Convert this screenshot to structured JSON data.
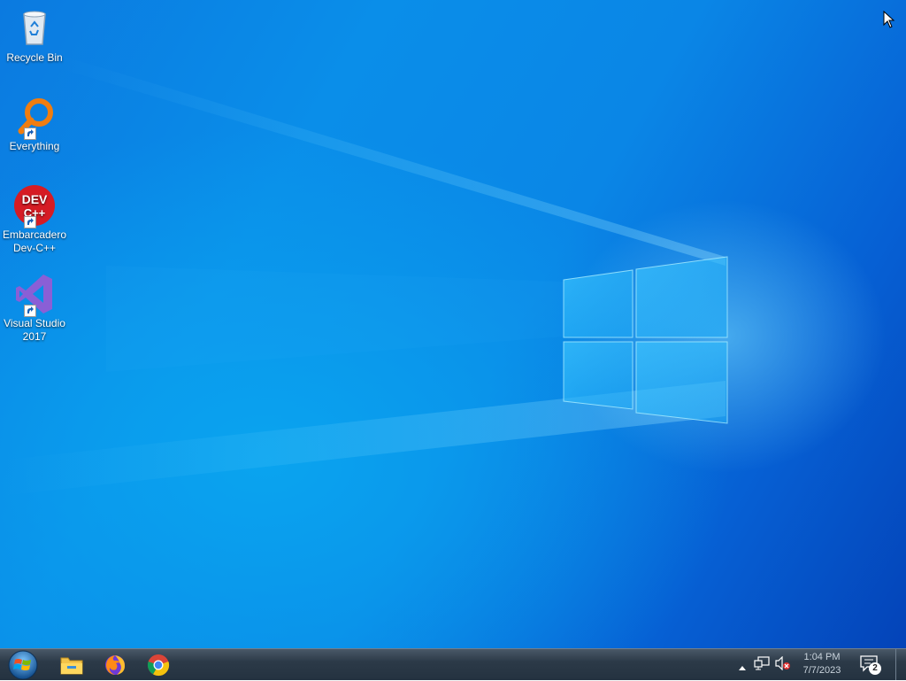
{
  "desktop": {
    "icons": [
      {
        "label": "Recycle Bin",
        "icon": "recycle-bin-icon"
      },
      {
        "label": "Everything",
        "icon": "everything-search-icon"
      },
      {
        "label": "Embarcadero Dev-C++",
        "icon": "devcpp-icon",
        "badge_top": "DEV",
        "badge_bottom": "C++"
      },
      {
        "label": "Visual Studio 2017",
        "icon": "visual-studio-icon"
      }
    ]
  },
  "taskbar": {
    "start": {
      "icon": "windows-start-orb-icon"
    },
    "pinned": [
      {
        "name": "File Explorer",
        "icon": "folder-icon"
      },
      {
        "name": "Firefox",
        "icon": "firefox-icon"
      },
      {
        "name": "Google Chrome",
        "icon": "chrome-icon"
      }
    ],
    "tray": {
      "show_hidden_icon": "chevron-up-icon",
      "network_icon": "network-icon",
      "volume_icon": "volume-muted-icon",
      "time": "1:04 PM",
      "date": "7/7/2023",
      "notification_count": "2"
    }
  },
  "colors": {
    "wallpaper_blue": "#0a86e6",
    "taskbar_bg": "#2c3a48"
  }
}
